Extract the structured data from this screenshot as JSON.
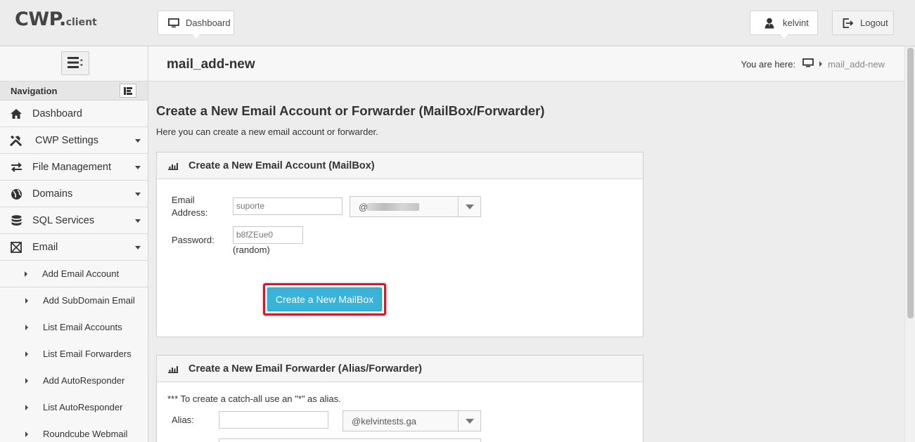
{
  "brand": {
    "name": "CWP",
    "dot": ".",
    "sub": "client"
  },
  "topbar": {
    "dashboard_label": "Dashboard",
    "user_label": "kelvint",
    "logout_label": "Logout"
  },
  "sidebar": {
    "nav_title": "Navigation",
    "items": [
      {
        "label": "Dashboard",
        "icon": "home-icon"
      },
      {
        "label": "CWP Settings",
        "icon": "tools-icon"
      },
      {
        "label": "File Management",
        "icon": "transfer-icon"
      },
      {
        "label": "Domains",
        "icon": "globe-icon"
      },
      {
        "label": "SQL Services",
        "icon": "database-icon"
      },
      {
        "label": "Email",
        "icon": "envelope-icon"
      }
    ],
    "email_sub_items": [
      "Add Email Account",
      "Add SubDomain Email",
      "List Email Accounts",
      "List Email Forwarders",
      "Add AutoResponder",
      "List AutoResponder",
      "Roundcube Webmail"
    ]
  },
  "page": {
    "title": "mail_add-new",
    "breadcrumb_prefix": "You are here:",
    "breadcrumb_current": "mail_add-new",
    "heading": "Create a New Email Account or Forwarder (MailBox/Forwarder)",
    "intro": "Here you can create a new email account or forwarder."
  },
  "mailbox_panel": {
    "title": "Create a New Email Account (MailBox)",
    "email_label_line1": "Email",
    "email_label_line2": "Address:",
    "email_value": "suporte",
    "domain_prefix": "@",
    "password_label": "Password:",
    "password_value": "b8fZEue0",
    "password_hint": "(random)",
    "submit_label": "Create a New MailBox"
  },
  "forwarder_panel": {
    "title": "Create a New Email Forwarder (Alias/Forwarder)",
    "note": "*** To create a catch-all use an \"*\" as alias.",
    "alias_label": "Alias:",
    "alias_value": "",
    "domain_value": "@kelvintests.ga"
  },
  "colors": {
    "accent": "#39b3d7",
    "highlight": "#c8202a"
  }
}
